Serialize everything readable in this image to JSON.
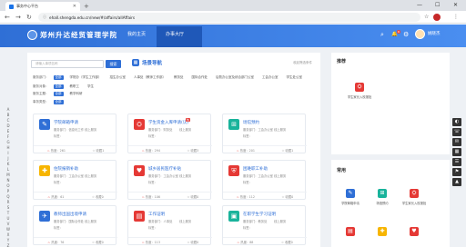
{
  "browser": {
    "tab_title": "事务中心平台",
    "url": "ehall.shengda.edu.cn/new/#/affairs/allAffairs",
    "new_tab_glyph": "+",
    "minimize_glyph": "—",
    "maximize_glyph": "☐",
    "close_glyph": "✕",
    "back_glyph": "←",
    "forward_glyph": "→",
    "reload_glyph": "↻",
    "lock_glyph": "ⓘ",
    "star_glyph": "☆",
    "menu_glyph": "⋮"
  },
  "header": {
    "site_name": "郑州升达经贸管理学院",
    "nav": [
      "我的主页",
      "办事大厅"
    ],
    "active_nav": "办事大厅",
    "search_glyph": "⌕",
    "bell_glyph": "🔔",
    "bell_badge": "6",
    "settings_glyph": "⚙",
    "username": "姚晓杰"
  },
  "search": {
    "placeholder": "请输入事项名称",
    "button": "搜索"
  },
  "scene_nav": {
    "icon": "▦",
    "label": "场景导航"
  },
  "collapse_label": "收起筛选条件",
  "filters": [
    {
      "label": "服务部门：",
      "options": [
        "全部",
        "学院办（学生工作部）",
        "招生办公室",
        "人事处（教师工作部）",
        "教务处",
        "国际合作处",
        "后勤办公室及综合部门公室",
        "工会办公室",
        "学生处公室"
      ],
      "selected": 0
    },
    {
      "label": "服务对象：",
      "options": [
        "全部",
        "教职工",
        "学生"
      ],
      "selected": 0
    },
    {
      "label": "服务主题：",
      "options": [
        "全部",
        "教学科研"
      ],
      "selected": 0
    },
    {
      "label": "事务类型：",
      "options": [
        "全部"
      ],
      "selected": 0
    }
  ],
  "alphabet": [
    "A",
    "B",
    "C",
    "D",
    "E",
    "F",
    "G",
    "H",
    "I",
    "J",
    "K",
    "L",
    "M",
    "N",
    "O",
    "P",
    "Q",
    "R",
    "S",
    "T",
    "U",
    "V",
    "W",
    "X",
    "Y",
    "Z"
  ],
  "card_labels": {
    "dept": "服务部门：",
    "online": "线上服务",
    "hot": "热度：",
    "fav": "收藏"
  },
  "cards": [
    {
      "title": "学院邮箱申请",
      "dept": "信息化工作",
      "online": "已开通",
      "tag": "标签：",
      "hot": "261",
      "fav": "1",
      "color": "#2f6fd6",
      "icon": "✎",
      "ribbon": ""
    },
    {
      "title": "学生资金入库申请(认)",
      "dept": "财务处",
      "online": "已开通",
      "tag": "标签：",
      "hot": "294",
      "fav": "3",
      "color": "#e53935",
      "icon": "⛭",
      "ribbon": "热"
    },
    {
      "title": "场馆预约",
      "dept": "工会办公室",
      "online": "已开通",
      "tag": "标签：",
      "hot": "201",
      "fav": "1",
      "color": "#19b39b",
      "icon": "⊞",
      "ribbon": ""
    },
    {
      "title": "住院报销补助",
      "dept": "工会办公室",
      "online": "已开通",
      "tag": "标签：",
      "hot": "61",
      "fav": "0",
      "color": "#f7b500",
      "icon": "✚",
      "ribbon": ""
    },
    {
      "title": "城乡居民医疗补贴",
      "dept": "工会办公室",
      "online": "已开通",
      "tag": "标签：",
      "hot": "106",
      "fav": "0",
      "color": "#e53935",
      "icon": "♥",
      "ribbon": ""
    },
    {
      "title": "困难职工补助",
      "dept": "工会办公室",
      "online": "已开通",
      "tag": "标签：",
      "hot": "112",
      "fav": "0",
      "color": "#e53935",
      "icon": "⛨",
      "ribbon": ""
    },
    {
      "title": "教师出国出境申请",
      "dept": "国际合作处",
      "online": "已开通",
      "tag": "标签：",
      "hot": "76",
      "fav": "0",
      "color": "#2f6fd6",
      "icon": "✈",
      "ribbon": ""
    },
    {
      "title": "工作证明",
      "dept": "人事处",
      "online": "已开通",
      "tag": "标签：",
      "hot": "113",
      "fav": "0",
      "color": "#e53935",
      "icon": "▤",
      "ribbon": ""
    },
    {
      "title": "在职学生学习证明",
      "dept": "教务处",
      "online": "已开通",
      "tag": "标签：",
      "hot": "88",
      "fav": "0",
      "color": "#19b39b",
      "icon": "▣",
      "ribbon": ""
    }
  ],
  "recommend": {
    "title": "推荐",
    "item": {
      "label": "学生家长入校报批",
      "color": "#e53935",
      "icon": "⛭"
    }
  },
  "common": {
    "title": "常用",
    "items": [
      {
        "label": "学院邮箱申请",
        "color": "#2f6fd6",
        "icon": "✎"
      },
      {
        "label": "场馆预约",
        "color": "#19b39b",
        "icon": "⊞"
      },
      {
        "label": "学生家长入校报批",
        "color": "#e53935",
        "icon": "⛭"
      },
      {
        "label": "",
        "color": "#e53935",
        "icon": "▤"
      },
      {
        "label": "",
        "color": "#f7b500",
        "icon": "✚"
      },
      {
        "label": "",
        "color": "#e53935",
        "icon": "♥"
      }
    ]
  },
  "float_toolbar": [
    "◐",
    "☏",
    "✉",
    "▦",
    "☰",
    "⚑",
    "▲"
  ]
}
